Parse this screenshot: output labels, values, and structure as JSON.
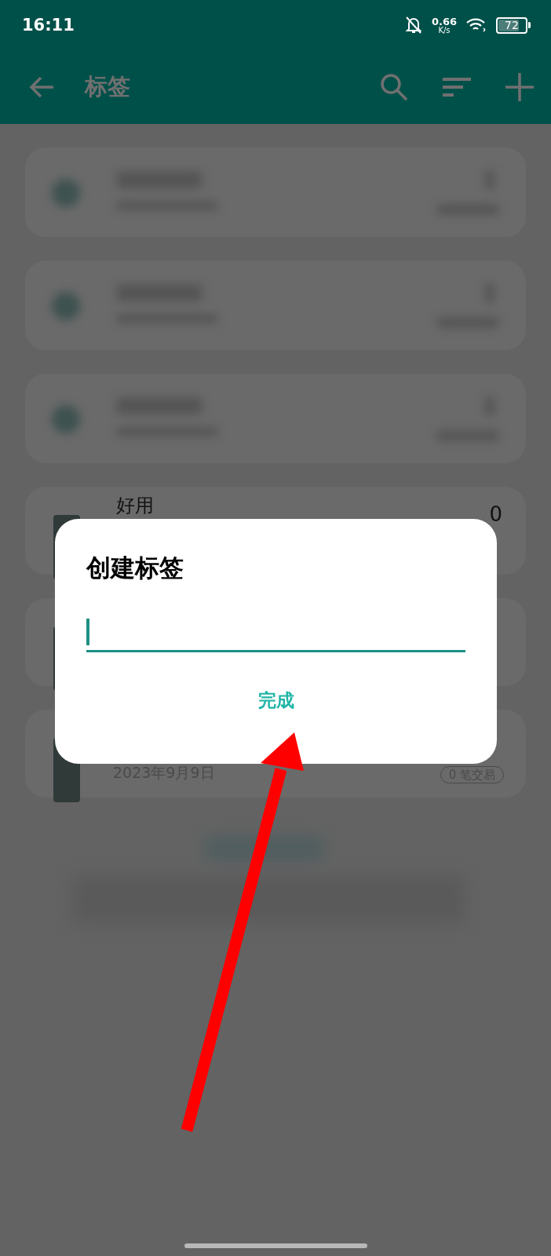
{
  "status_bar": {
    "time": "16:11",
    "net_speed": "0.66",
    "net_unit": "K/s",
    "battery": "72"
  },
  "app_bar": {
    "title": "标签"
  },
  "list": {
    "items": [
      {
        "kind": "blurred"
      },
      {
        "kind": "blurred"
      },
      {
        "kind": "blurred"
      },
      {
        "kind": "tag",
        "name": "好用",
        "amount": "0"
      },
      {
        "kind": "tag"
      },
      {
        "kind": "tag",
        "date": "2023年9月9日",
        "count": "0 笔交易"
      },
      {
        "kind": "blurred-hint"
      }
    ]
  },
  "dialog": {
    "title": "创建标签",
    "field": {
      "focused": true
    },
    "button": "完成"
  },
  "annotation": {
    "kind": "arrow"
  }
}
